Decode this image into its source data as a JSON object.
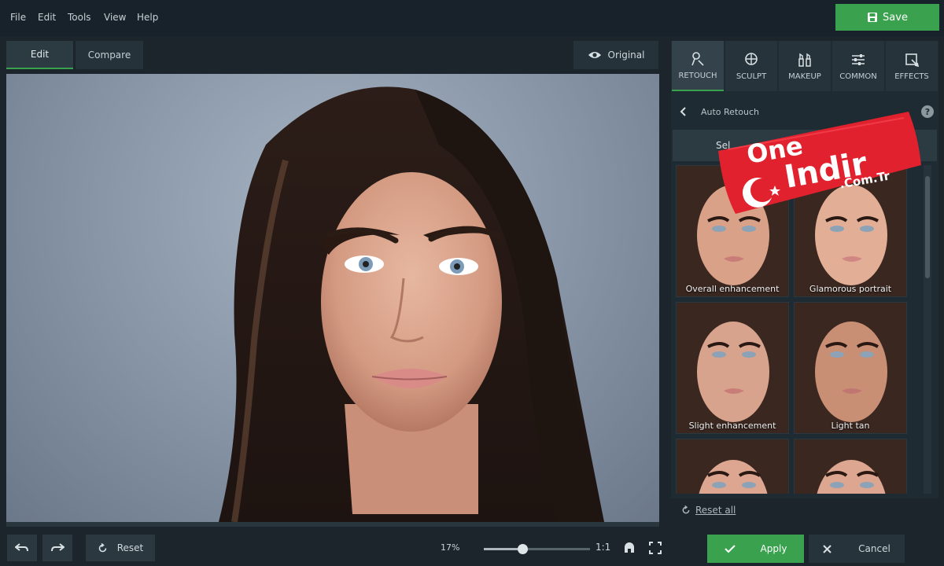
{
  "menu": [
    "File",
    "Edit",
    "Tools",
    "View",
    "Help"
  ],
  "save_label": "Save",
  "view_tabs": {
    "edit": "Edit",
    "compare": "Compare"
  },
  "original_label": "Original",
  "bottom": {
    "reset_label": "Reset",
    "zoom": "17%",
    "zoom_fraction": 0.36,
    "one_to_one": "1:1"
  },
  "panel": {
    "tabs": [
      "RETOUCH",
      "SCULPT",
      "MAKEUP",
      "COMMON",
      "EFFECTS"
    ],
    "breadcrumb": "Auto Retouch",
    "help": "?",
    "selected_tab": "Sel",
    "presets": [
      "Overall enhancement",
      "Glamorous portrait",
      "Slight enhancement",
      "Light tan",
      "",
      ""
    ],
    "reset_all": "Reset all",
    "apply_label": "Apply",
    "cancel_label": "Cancel"
  },
  "watermark": {
    "line1": "One",
    "line2": "Indir",
    "line3": ".Com.Tr"
  },
  "colors": {
    "accent": "#3aa24f",
    "watermark": "#e2212e",
    "background": "#1b252b"
  }
}
